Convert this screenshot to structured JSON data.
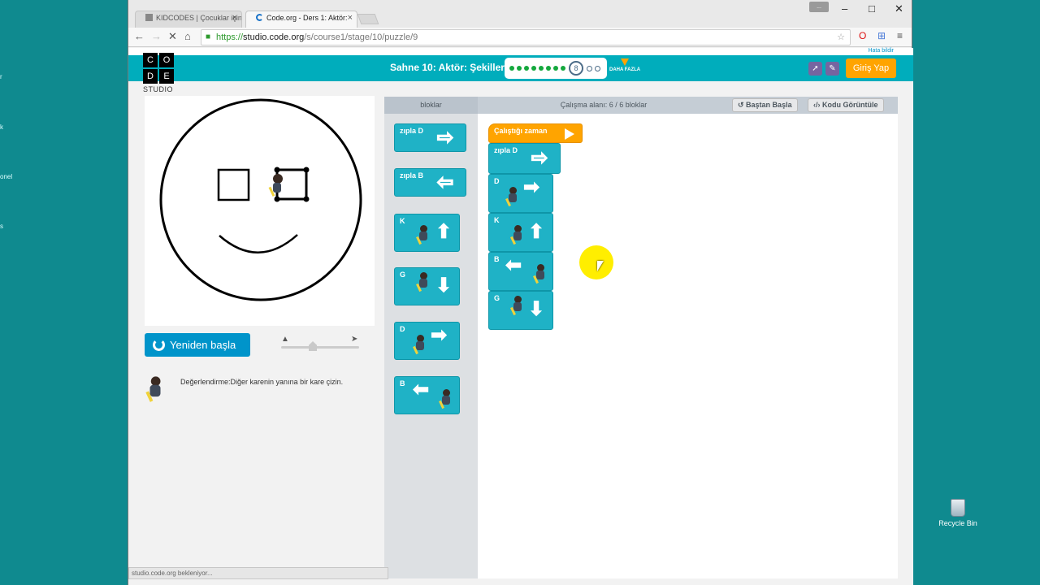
{
  "browser": {
    "tabs": [
      {
        "title": "KIDCODES | Çocuklar için"
      },
      {
        "title": "Code.org - Ders 1: Aktör:"
      }
    ],
    "user_label": "...",
    "url": {
      "scheme": "https://",
      "host": "studio.code.org",
      "path": "/s/course1/stage/10/puzzle/9"
    },
    "status_text": "studio.code.org bekleniyor..."
  },
  "header": {
    "report_link": "Hata bildir",
    "logo_letters": [
      "C",
      "O",
      "D",
      "E"
    ],
    "logo_studio": "STUDIO",
    "stage_title": "Sahne 10: Aktör: Şekiller",
    "progress": {
      "completed": 8,
      "current": "8",
      "remaining": 2
    },
    "more_label": "DAHA FAZLA",
    "login_button": "Giriş Yap"
  },
  "game": {
    "reset_button": "Yeniden başla",
    "instructions": "Değerlendirme:Diğer karenin yanına bir kare çizin."
  },
  "workspace_header": {
    "toolbox_label": "bloklar",
    "workspace_label": "Çalışma alanı: 6 / 6 bloklar",
    "start_over": "Baştan Başla",
    "show_code": "Kodu Görüntüle"
  },
  "toolbox_blocks": [
    {
      "label": "zıpla  D",
      "direction": "right",
      "kind": "jump"
    },
    {
      "label": "zıpla  B",
      "direction": "left",
      "kind": "jump"
    },
    {
      "label": "K",
      "direction": "up",
      "kind": "move"
    },
    {
      "label": "G",
      "direction": "down",
      "kind": "move"
    },
    {
      "label": "D",
      "direction": "right",
      "kind": "move"
    },
    {
      "label": "B",
      "direction": "left",
      "kind": "move"
    }
  ],
  "program": {
    "when_run": "Çalıştığı zaman",
    "blocks": [
      {
        "label": "zıpla  D",
        "direction": "right",
        "kind": "jump"
      },
      {
        "label": "D",
        "direction": "right",
        "kind": "move"
      },
      {
        "label": "K",
        "direction": "up",
        "kind": "move"
      },
      {
        "label": "B",
        "direction": "left",
        "kind": "move"
      },
      {
        "label": "G",
        "direction": "down",
        "kind": "move"
      }
    ]
  },
  "desktop": {
    "edge_labels": [
      "r",
      "k",
      "onel",
      "s"
    ],
    "recycle_bin": "Recycle Bin"
  },
  "colors": {
    "header": "#00adbc",
    "block": "#1fb2c6",
    "when_run": "#ffa400",
    "reset": "#0094ca",
    "progress_done": "#14a83d"
  }
}
